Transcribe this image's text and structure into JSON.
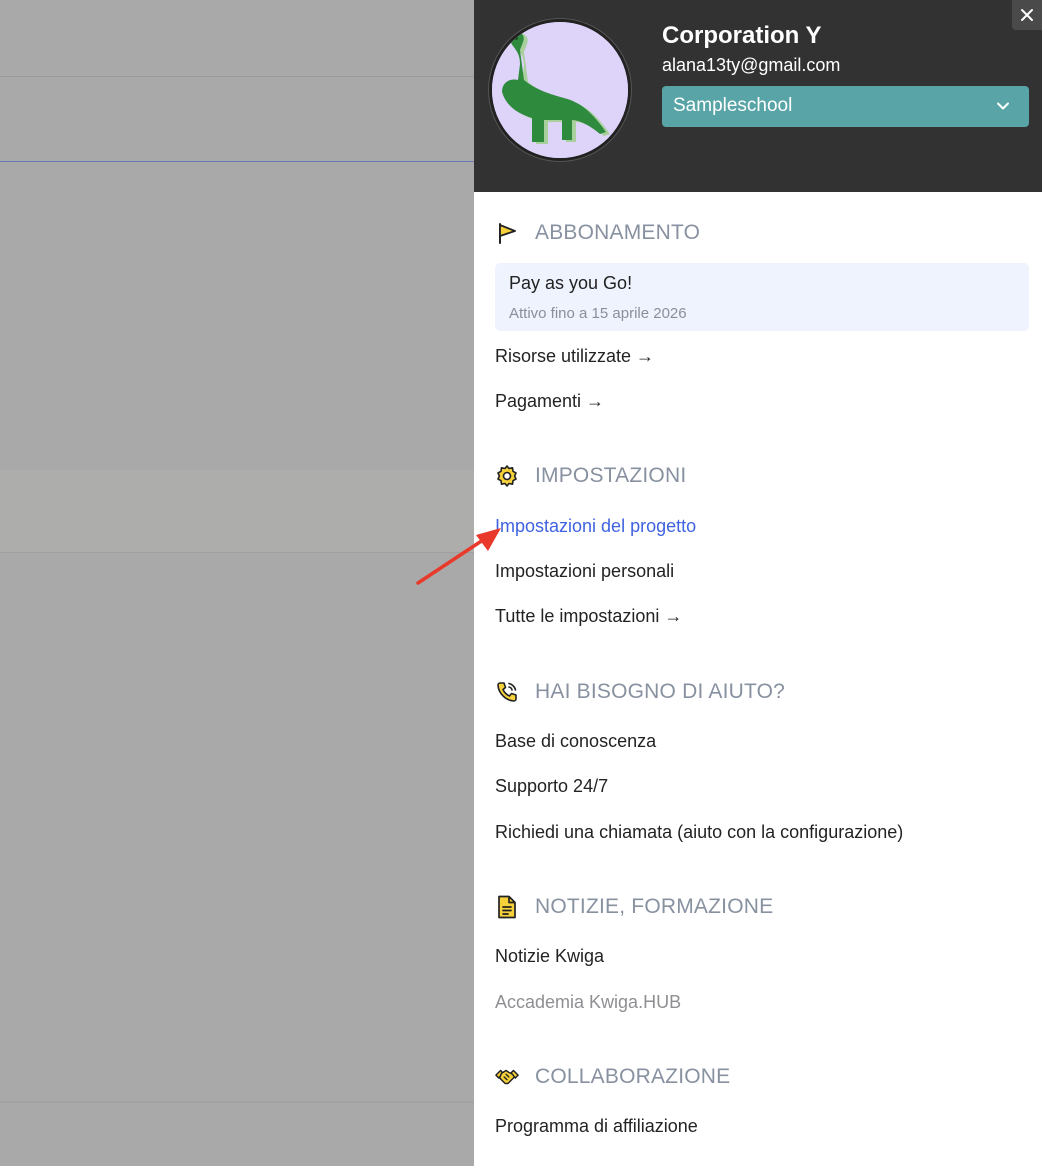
{
  "header": {
    "company": "Corporation Y",
    "email": "alana13ty@gmail.com",
    "school_selected": "Sampleschool"
  },
  "sections": {
    "subscription": {
      "title": "ABBONAMENTO",
      "plan_name": "Pay as you Go!",
      "plan_status": "Attivo fino a 15 aprile 2026",
      "links": [
        "Risorse utilizzate →",
        "Pagamenti →"
      ]
    },
    "settings": {
      "title": "IMPOSTAZIONI",
      "links": [
        "Impostazioni del progetto",
        "Impostazioni personali",
        "Tutte le impostazioni →"
      ]
    },
    "help": {
      "title": "HAI BISOGNO DI AIUTO?",
      "links": [
        "Base di conoscenza",
        "Supporto 24/7",
        "Richiedi una chiamata (aiuto con la configurazione)"
      ]
    },
    "news": {
      "title": "NOTIZIE, FORMAZIONE",
      "links": [
        "Notizie Kwiga",
        "Accademia Kwiga.HUB"
      ]
    },
    "collab": {
      "title": "COLLABORAZIONE",
      "links": [
        "Programma di affiliazione"
      ]
    }
  },
  "colors": {
    "header_bg": "#333233",
    "select_bg": "#58a4a6",
    "active_link": "#3f63e0",
    "section_title": "#8891a0",
    "annotation_arrow": "#e8392a"
  },
  "icons": {
    "subscription": "flag-icon",
    "settings": "gear-icon",
    "help": "phone-icon",
    "news": "document-icon",
    "collab": "handshake-icon",
    "close": "close-icon",
    "select": "chevron-down-icon"
  }
}
